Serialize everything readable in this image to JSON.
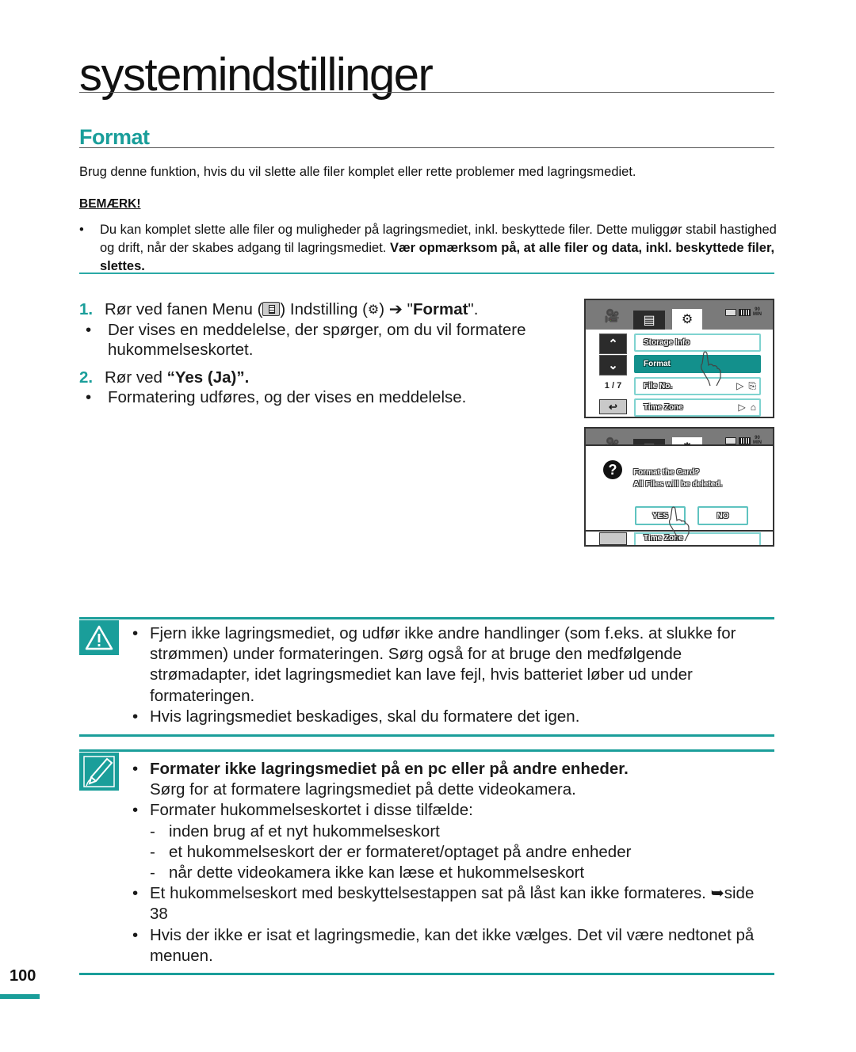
{
  "page": {
    "title": "systemindstillinger",
    "section_title": "Format",
    "intro": "Brug denne funktion, hvis du vil slette alle filer komplet eller rette problemer med lagringsmediet.",
    "page_number": "100"
  },
  "note": {
    "heading": "BEMÆRK!",
    "bullet": "•",
    "text_plain": "Du kan komplet slette alle filer og muligheder på lagringsmediet, inkl. beskyttede filer. Dette muliggør stabil hastighed og drift, når der skabes adgang til lagringsmediet. ",
    "text_bold": "Vær opmærksom på, at alle filer og data, inkl. beskyttede filer, slettes."
  },
  "steps": [
    {
      "number": "1.",
      "text_a": "Rør ved fanen Menu (",
      "text_b": ") Indstilling (",
      "text_c": ") ➔ \"",
      "text_bold": "Format",
      "text_d": "\".",
      "gear_glyph": "⚙",
      "sub": "Der vises en meddelelse, der spørger, om du vil formatere hukommelseskortet."
    },
    {
      "number": "2.",
      "text_a": "Rør ved ",
      "text_bold": "“Yes (Ja)”.",
      "sub": "Formatering udføres, og der vises en meddelelse."
    }
  ],
  "screen1": {
    "tabs": {
      "camera": "🎥",
      "menu": "▤",
      "settings": "⚙"
    },
    "status": {
      "remaining": "90",
      "unit": "MIN"
    },
    "up_label": "⌃",
    "down_label": "⌄",
    "page_indicator": "1 / 7",
    "back_label": "↩",
    "items": [
      {
        "label": "Storage Info",
        "selected": false
      },
      {
        "label": "Format",
        "selected": true
      },
      {
        "label": "File No.",
        "selected": false,
        "arrow": "▷",
        "icon": "⎘"
      },
      {
        "label": "Time Zone",
        "selected": false,
        "arrow": "▷",
        "icon": "⌂"
      }
    ]
  },
  "screen2": {
    "question_icon": "?",
    "message_line1": "Format the Card?",
    "message_line2": "All Files will be deleted.",
    "yes_label": "YES",
    "no_label": "NO",
    "bottom_row_label": "Time Zone"
  },
  "caution": {
    "items": [
      "Fjern ikke lagringsmediet, og udfør ikke andre handlinger (som f.eks. at slukke for strømmen) under formateringen. Sørg også for at bruge den medfølgende strømadapter, idet lagringsmediet kan lave fejl, hvis batteriet løber ud under formateringen.",
      "Hvis lagringsmediet beskadiges, skal du formatere det igen."
    ]
  },
  "memo": {
    "item1_bold": "Formater ikke lagringsmediet på en pc eller på andre enheder.",
    "item1_text": "Sørg for at formatere lagringsmediet på dette videokamera.",
    "item2": "Formater hukommelseskortet i disse tilfælde:",
    "dashes": [
      "inden brug af et nyt hukommelseskort",
      "et hukommelseskort der er formateret/optaget på andre enheder",
      "når dette videokamera ikke kan læse et hukommelseskort"
    ],
    "item3": "Et hukommelseskort med beskyttelsestappen sat på låst kan ikke formateres. ➥side 38",
    "item4": "Hvis der ikke er isat et lagringsmedie, kan det ikke vælges. Det vil være nedtonet på menuen."
  },
  "symbols": {
    "bullet": "•",
    "dash": "-"
  },
  "colors": {
    "accent": "#1a9e9a",
    "selected_row": "#13908c"
  }
}
